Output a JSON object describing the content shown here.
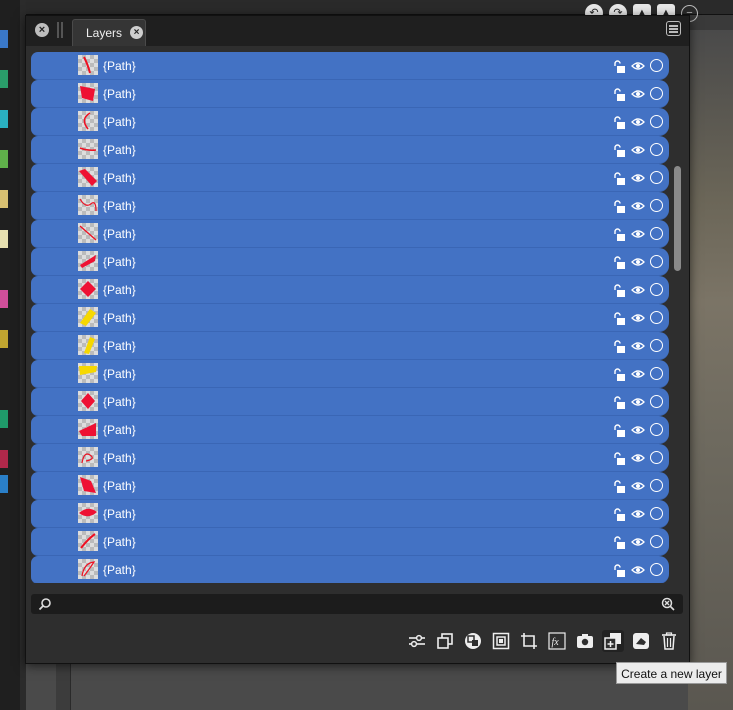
{
  "panel": {
    "tab_label": "Layers"
  },
  "layers": [
    {
      "name": "{Path}",
      "thumb": "stroke-thin"
    },
    {
      "name": "{Path}",
      "thumb": "quad-red"
    },
    {
      "name": "{Path}",
      "thumb": "curve-arc"
    },
    {
      "name": "{Path}",
      "thumb": "line-h"
    },
    {
      "name": "{Path}",
      "thumb": "band-diag"
    },
    {
      "name": "{Path}",
      "thumb": "scribble"
    },
    {
      "name": "{Path}",
      "thumb": "line-diag"
    },
    {
      "name": "{Path}",
      "thumb": "wedge"
    },
    {
      "name": "{Path}",
      "thumb": "blob-red"
    },
    {
      "name": "{Path}",
      "thumb": "band-yellow"
    },
    {
      "name": "{Path}",
      "thumb": "band-yellow-thin"
    },
    {
      "name": "{Path}",
      "thumb": "patch-yellow"
    },
    {
      "name": "{Path}",
      "thumb": "diamond-red"
    },
    {
      "name": "{Path}",
      "thumb": "wedge-low"
    },
    {
      "name": "{Path}",
      "thumb": "scribble-2"
    },
    {
      "name": "{Path}",
      "thumb": "quad-red-2"
    },
    {
      "name": "{Path}",
      "thumb": "leaf-red"
    },
    {
      "name": "{Path}",
      "thumb": "line-steep"
    },
    {
      "name": "{Path}",
      "thumb": "curve-loop"
    }
  ],
  "search": {
    "value": "",
    "placeholder": ""
  },
  "toolbar_icons": [
    "adjustments-icon",
    "duplicate-icon",
    "blend-icon",
    "group-icon",
    "crop-icon",
    "fx-icon",
    "snapshot-icon",
    "new-layer-icon",
    "mask-icon",
    "trash-icon"
  ],
  "tooltip": "Create a new layer",
  "colors": {
    "row_selected": "#4372c4",
    "panel_bg": "#2e2e2e",
    "thumb_red": "#ee1133",
    "thumb_yellow": "#f6d800"
  }
}
